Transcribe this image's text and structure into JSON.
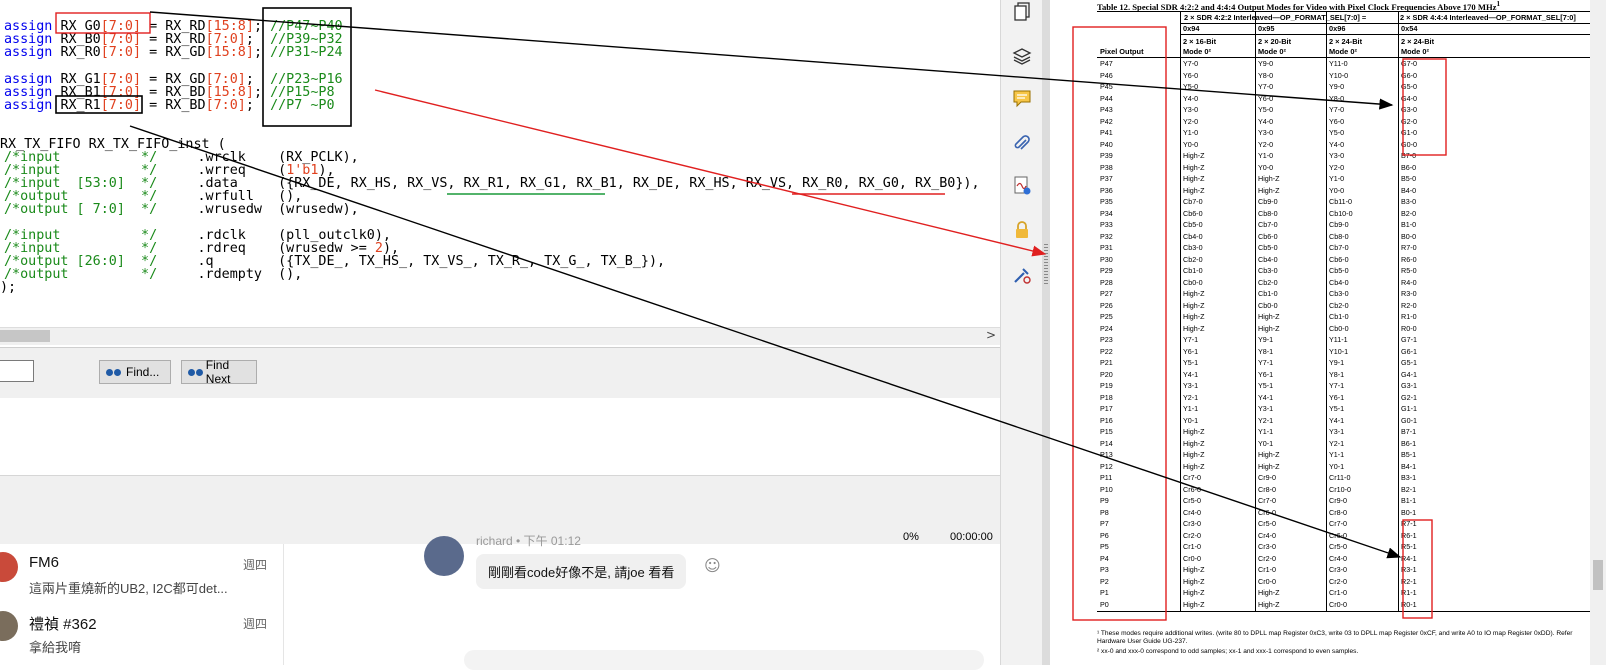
{
  "editor": {
    "assign_kw": "assign",
    "assigns": [
      {
        "lhs": "RX_G0",
        "lbr": "[7:0]",
        "rhs": "RX_RD",
        "rbr": "[15:8]",
        "cmt": "//P47~P40"
      },
      {
        "lhs": "RX_B0",
        "lbr": "[7:0]",
        "rhs": "RX_RD",
        "rbr": "[7:0]",
        "cmt": "//P39~P32"
      },
      {
        "lhs": "RX_R0",
        "lbr": "[7:0]",
        "rhs": "RX_GD",
        "rbr": "[15:8]",
        "cmt": "//P31~P24"
      },
      {
        "lhs": "RX_G1",
        "lbr": "[7:0]",
        "rhs": "RX_GD",
        "rbr": "[7:0]",
        "cmt": "//P23~P16"
      },
      {
        "lhs": "RX_B1",
        "lbr": "[7:0]",
        "rhs": "RX_BD",
        "rbr": "[15:8]",
        "cmt": "//P15~P8"
      },
      {
        "lhs": "RX_R1",
        "lbr": "[7:0]",
        "rhs": "RX_BD",
        "rbr": "[7:0]",
        "cmt": "//P7 ~P0"
      }
    ],
    "inst_line": "RX_TX_FIFO RX_TX_FIFO_inst (",
    "ports": [
      {
        "cmt": "/*input          */",
        "port": ".wrclk ",
        "val": "(RX_PCLK),"
      },
      {
        "cmt": "/*input          */",
        "port": ".wrreq ",
        "val_pre": "(",
        "val_num": "1'b1",
        "val_post": "),"
      },
      {
        "cmt": "/*input  [53:0]  */",
        "port": ".data  ",
        "val": "({RX_DE, RX_HS, RX_VS, RX_R1, RX_G1, RX_B1, RX_DE, RX_HS, RX_VS, RX_R0, RX_G0, RX_B0}),"
      },
      {
        "cmt": "/*output         */",
        "port": ".wrfull",
        "val": "(),"
      },
      {
        "cmt": "/*output [ 7:0]  */",
        "port": ".wrusedw",
        "val": "(wrusedw),"
      },
      {
        "cmt": "/*input          */",
        "port": ".rdclk ",
        "val": "(pll_outclk0),"
      },
      {
        "cmt": "/*input          */",
        "port": ".rdreq ",
        "val_pre": "(wrusedw >= ",
        "val_num": "2",
        "val_post": "),"
      },
      {
        "cmt": "/*output [26:0]  */",
        "port": ".q     ",
        "val": "({TX_DE_, TX_HS_, TX_VS_, TX_R_, TX_G_, TX_B_}),"
      },
      {
        "cmt": "/*output         */",
        "port": ".rdempty",
        "val": "(),"
      }
    ],
    "close_line": ");"
  },
  "scroll": {
    "right_arrow": ">"
  },
  "findbar": {
    "find_label": "Find...",
    "find_next_label": "Find Next"
  },
  "status": {
    "percent": "0%",
    "time": "00:00:00"
  },
  "chat": {
    "items": [
      {
        "name": "FM6",
        "preview": "這兩片重燒新的UB2, I2C都可det...",
        "day": "週四"
      },
      {
        "name": "禮禎 #362",
        "preview": "拿給我唷",
        "day": "週四"
      }
    ],
    "message": {
      "sender": "richard • 下午 01:12",
      "text": "剛剛看code好像不是, 請joe 看看"
    }
  },
  "colors": {
    "keyword": "#0000ee",
    "number": "#e0411f",
    "comment": "#1a8a1a",
    "annotation_red": "#e02020",
    "underline_green": "#1a9a3a"
  },
  "toolbar_icons": [
    "pages-icon",
    "layers-icon",
    "comment-icon",
    "attachment-icon",
    "signature-icon",
    "lock-icon",
    "sign-tool-icon"
  ],
  "pdf": {
    "title": "Table 12. Special SDR 4:2:2 and 4:4:4 Output Modes for Video with Pixel Clock Frequencies Above 170 MHz",
    "title_sup": "1",
    "group1": "2 × SDR 4:2:2 Interleaved—OP_FORMAT_SEL[7:0] =",
    "group2": "2 × SDR 4:4:4 Interleaved—OP_FORMAT_SEL[7:0]",
    "codes": [
      "0x94",
      "0x95",
      "0x96",
      "0x54"
    ],
    "modes": [
      [
        "2 × 16-Bit",
        "Mode 0²"
      ],
      [
        "2 × 20-Bit",
        "Mode 0²"
      ],
      [
        "2 × 24-Bit",
        "Mode 0²"
      ],
      [
        "2 × 24-Bit",
        "Mode 0²"
      ]
    ],
    "col_header": "Pixel Output",
    "rows": [
      [
        "P47",
        "Y7-0",
        "Y9-0",
        "Y11-0",
        "G7-0"
      ],
      [
        "P46",
        "Y6-0",
        "Y8-0",
        "Y10-0",
        "G6-0"
      ],
      [
        "P45",
        "Y5-0",
        "Y7-0",
        "Y9-0",
        "G5-0"
      ],
      [
        "P44",
        "Y4-0",
        "Y6-0",
        "Y8-0",
        "G4-0"
      ],
      [
        "P43",
        "Y3-0",
        "Y5-0",
        "Y7-0",
        "G3-0"
      ],
      [
        "P42",
        "Y2-0",
        "Y4-0",
        "Y6-0",
        "G2-0"
      ],
      [
        "P41",
        "Y1-0",
        "Y3-0",
        "Y5-0",
        "G1-0"
      ],
      [
        "P40",
        "Y0-0",
        "Y2-0",
        "Y4-0",
        "G0-0"
      ],
      [
        "P39",
        "High-Z",
        "Y1-0",
        "Y3-0",
        "B7-0"
      ],
      [
        "P38",
        "High-Z",
        "Y0-0",
        "Y2-0",
        "B6-0"
      ],
      [
        "P37",
        "High-Z",
        "High-Z",
        "Y1-0",
        "B5-0"
      ],
      [
        "P36",
        "High-Z",
        "High-Z",
        "Y0-0",
        "B4-0"
      ],
      [
        "P35",
        "Cb7-0",
        "Cb9-0",
        "Cb11-0",
        "B3-0"
      ],
      [
        "P34",
        "Cb6-0",
        "Cb8-0",
        "Cb10-0",
        "B2-0"
      ],
      [
        "P33",
        "Cb5-0",
        "Cb7-0",
        "Cb9-0",
        "B1-0"
      ],
      [
        "P32",
        "Cb4-0",
        "Cb6-0",
        "Cb8-0",
        "B0-0"
      ],
      [
        "P31",
        "Cb3-0",
        "Cb5-0",
        "Cb7-0",
        "R7-0"
      ],
      [
        "P30",
        "Cb2-0",
        "Cb4-0",
        "Cb6-0",
        "R6-0"
      ],
      [
        "P29",
        "Cb1-0",
        "Cb3-0",
        "Cb5-0",
        "R5-0"
      ],
      [
        "P28",
        "Cb0-0",
        "Cb2-0",
        "Cb4-0",
        "R4-0"
      ],
      [
        "P27",
        "High-Z",
        "Cb1-0",
        "Cb3-0",
        "R3-0"
      ],
      [
        "P26",
        "High-Z",
        "Cb0-0",
        "Cb2-0",
        "R2-0"
      ],
      [
        "P25",
        "High-Z",
        "High-Z",
        "Cb1-0",
        "R1-0"
      ],
      [
        "P24",
        "High-Z",
        "High-Z",
        "Cb0-0",
        "R0-0"
      ],
      [
        "P23",
        "Y7-1",
        "Y9-1",
        "Y11-1",
        "G7-1"
      ],
      [
        "P22",
        "Y6-1",
        "Y8-1",
        "Y10-1",
        "G6-1"
      ],
      [
        "P21",
        "Y5-1",
        "Y7-1",
        "Y9-1",
        "G5-1"
      ],
      [
        "P20",
        "Y4-1",
        "Y6-1",
        "Y8-1",
        "G4-1"
      ],
      [
        "P19",
        "Y3-1",
        "Y5-1",
        "Y7-1",
        "G3-1"
      ],
      [
        "P18",
        "Y2-1",
        "Y4-1",
        "Y6-1",
        "G2-1"
      ],
      [
        "P17",
        "Y1-1",
        "Y3-1",
        "Y5-1",
        "G1-1"
      ],
      [
        "P16",
        "Y0-1",
        "Y2-1",
        "Y4-1",
        "G0-1"
      ],
      [
        "P15",
        "High-Z",
        "Y1-1",
        "Y3-1",
        "B7-1"
      ],
      [
        "P14",
        "High-Z",
        "Y0-1",
        "Y2-1",
        "B6-1"
      ],
      [
        "P13",
        "High-Z",
        "High-Z",
        "Y1-1",
        "B5-1"
      ],
      [
        "P12",
        "High-Z",
        "High-Z",
        "Y0-1",
        "B4-1"
      ],
      [
        "P11",
        "Cr7-0",
        "Cr9-0",
        "Cr11-0",
        "B3-1"
      ],
      [
        "P10",
        "Cr6-0",
        "Cr8-0",
        "Cr10-0",
        "B2-1"
      ],
      [
        "P9",
        "Cr5-0",
        "Cr7-0",
        "Cr9-0",
        "B1-1"
      ],
      [
        "P8",
        "Cr4-0",
        "Cr6-0",
        "Cr8-0",
        "B0-1"
      ],
      [
        "P7",
        "Cr3-0",
        "Cr5-0",
        "Cr7-0",
        "R7-1"
      ],
      [
        "P6",
        "Cr2-0",
        "Cr4-0",
        "Cr6-0",
        "R6-1"
      ],
      [
        "P5",
        "Cr1-0",
        "Cr3-0",
        "Cr5-0",
        "R5-1"
      ],
      [
        "P4",
        "Cr0-0",
        "Cr2-0",
        "Cr4-0",
        "R4-1"
      ],
      [
        "P3",
        "High-Z",
        "Cr1-0",
        "Cr3-0",
        "R3-1"
      ],
      [
        "P2",
        "High-Z",
        "Cr0-0",
        "Cr2-0",
        "R2-1"
      ],
      [
        "P1",
        "High-Z",
        "High-Z",
        "Cr1-0",
        "R1-1"
      ],
      [
        "P0",
        "High-Z",
        "High-Z",
        "Cr0-0",
        "R0-1"
      ]
    ],
    "footnote1": "¹ These modes require additional writes. (write 80 to DPLL map Register 0xC3, write 03 to DPLL map Register 0xCF, and write A0 to IO map Register 0xDD). Refer",
    "footnote1b": "   Hardware User Guide UG-237.",
    "footnote2": "² xx-0 and xxx-0 correspond to odd samples; xx-1 and xxx-1 correspond to even samples."
  }
}
